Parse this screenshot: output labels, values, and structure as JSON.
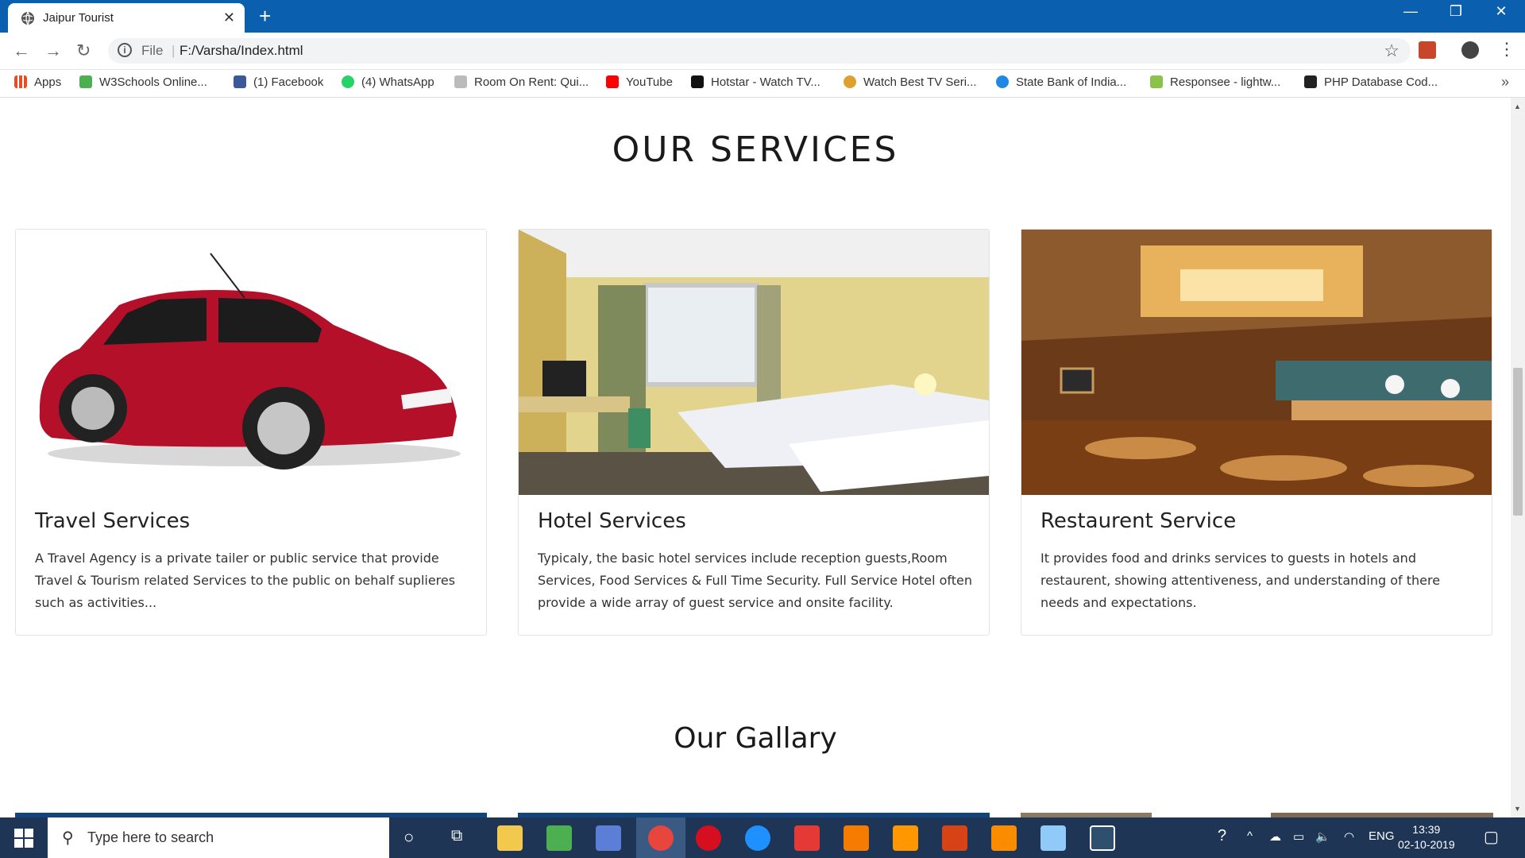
{
  "browser": {
    "tab_title": "Jaipur Tourist",
    "tab_close": "✕",
    "new_tab": "+",
    "window_controls": [
      "—",
      "❐",
      "✕"
    ],
    "url_scheme": "File",
    "url_sep": "|",
    "url": "F:/Varsha/Index.html"
  },
  "bookmarks": [
    {
      "label": "Apps",
      "color": "#e44d26"
    },
    {
      "label": "W3Schools Online...",
      "color": "#4caf50"
    },
    {
      "label": "(1) Facebook",
      "color": "#3b5998"
    },
    {
      "label": "(4) WhatsApp",
      "color": "#25d366"
    },
    {
      "label": "Room On Rent: Qui...",
      "color": "#888888"
    },
    {
      "label": "YouTube",
      "color": "#ff0000"
    },
    {
      "label": "Hotstar - Watch TV...",
      "color": "#111111"
    },
    {
      "label": "Watch Best TV Seri...",
      "color": "#e0a030"
    },
    {
      "label": "State Bank of India...",
      "color": "#1e88e5"
    },
    {
      "label": "Responsee - lightw...",
      "color": "#8bc34a"
    },
    {
      "label": "PHP Database Cod...",
      "color": "#222222"
    }
  ],
  "page": {
    "services_heading": "OUR SERVICES",
    "gallery_heading": "Our Gallary",
    "cards": [
      {
        "title": "Travel Services",
        "text": "A Travel Agency is a private tailer or public service that provide Travel & Tourism related Services to the public on behalf suplieres such as activities..."
      },
      {
        "title": "Hotel Services",
        "text": "Typicaly, the basic hotel services include reception guests,Room Services, Food Services & Full Time Security. Full Service Hotel often provide a wide array of guest service and onsite facility."
      },
      {
        "title": "Restaurent Service",
        "text": "It provides food and drinks services to guests in hotels and restaurent, showing attentiveness, and understanding of there needs and expectations."
      }
    ]
  },
  "taskbar": {
    "search_placeholder": "Type here to search",
    "language": "ENG",
    "time": "13:39",
    "date": "02-10-2019"
  }
}
